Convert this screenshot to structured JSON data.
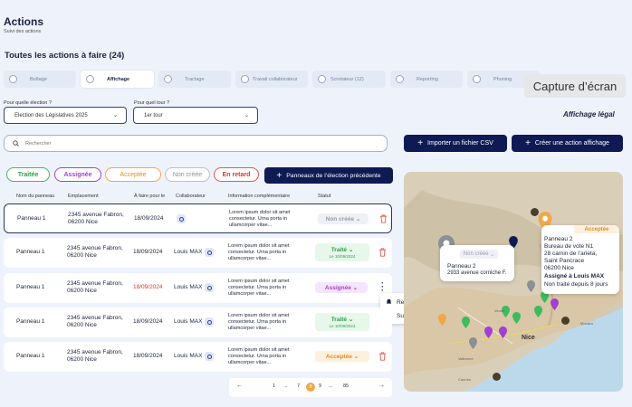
{
  "header": {
    "title": "Actions",
    "subtitle": "Suivi des actions",
    "todo_title": "Toutes les actions à faire (24)"
  },
  "tabs": [
    {
      "label": "Boîtage",
      "icon": "mailbox-icon"
    },
    {
      "label": "Affichage",
      "icon": "poster-icon",
      "active": true
    },
    {
      "label": "Tractage",
      "icon": "flyer-icon"
    },
    {
      "label": "Travail collaborateur",
      "icon": "team-icon"
    },
    {
      "label": "Scrutateur (12)",
      "icon": "ballot-icon"
    },
    {
      "label": "Reporting",
      "icon": "chart-icon"
    },
    {
      "label": "Phoning",
      "icon": "phone-icon"
    }
  ],
  "capture_label": "Capture d’écran",
  "filters": {
    "election_label": "Pour quelle élection ?",
    "election_value": "Election des Législatives 2025",
    "tour_label": "Pour quel tour ?",
    "tour_value": "1er tour"
  },
  "affichage_legal": "Affichage légal",
  "search": {
    "placeholder": "Rechercher"
  },
  "buttons": {
    "import_csv": "Importer un fichier CSV",
    "create_action": "Créer une action affichage",
    "previous_panels": "Panneaux de l’élection précédente"
  },
  "chips": {
    "traitee": "Traitée",
    "assignee": "Assignée",
    "acceptee": "Acceptée",
    "non_creee": "Non créée",
    "en_retard": "En retard"
  },
  "table": {
    "headers": {
      "name": "Nom du panneau",
      "location": "Emplacement",
      "due": "À faire pour le",
      "collab": "Collaborateur",
      "info": "Information complémentaire",
      "status": "Statut"
    },
    "rows": [
      {
        "name": "Panneau 1",
        "addr1": "2345 avenue Fabron,",
        "addr2": "06200 Nice",
        "date": "18/09/2024",
        "collab": "",
        "info": "Lorem ipsum dolor sit amet consectetur. Urna porta in ullamcorper vitae...",
        "status": "Non créée",
        "status_date": ""
      },
      {
        "name": "Panneau 1",
        "addr1": "2345 avenue Fabron,",
        "addr2": "06200 Nice",
        "date": "18/09/2024",
        "collab": "Louis MAX",
        "info": "Lorem ipsum dolor sit amet consectetur. Urna porta in ullamcorper vitae...",
        "status": "Traité",
        "status_date": "Le 10/09/2024"
      },
      {
        "name": "Panneau 1",
        "addr1": "2345 avenue Fabron,",
        "addr2": "06200 Nice",
        "date": "18/09/2024",
        "collab": "Louis MAX",
        "info": "Lorem ipsum dolor sit amet consectetur. Urna porta in ullamcorper vitae...",
        "status": "Assignée",
        "status_date": ""
      },
      {
        "name": "Panneau 1",
        "addr1": "2345 avenue Fabron,",
        "addr2": "06200 Nice",
        "date": "18/09/2024",
        "collab": "Louis MAX",
        "info": "Lorem ipsum dolor sit amet consectetur. Urna porta in ullamcorper vitae...",
        "status": "Traité",
        "status_date": "Le 10/09/2024"
      },
      {
        "name": "Panneau 1",
        "addr1": "2345 avenue Fabron,",
        "addr2": "06200 Nice",
        "date": "18/09/2024",
        "collab": "Louis MAX",
        "info": "Lorem ipsum dolor sit amet consectetur. Urna porta in ullamcorper vitae...",
        "status": "Acceptée",
        "status_date": ""
      }
    ]
  },
  "row_menu": {
    "remind": "Relancer",
    "delete": "Supprimer"
  },
  "pagination": {
    "pages": [
      "1",
      "...",
      "7",
      "8",
      "9",
      "...",
      "85"
    ],
    "current": "8"
  },
  "map": {
    "gray_popup": {
      "status": "Non créée",
      "name": "Panneau 2",
      "address": "2933 avenue corniche F."
    },
    "orange_popup": {
      "status": "Acceptée",
      "line1": "Panneau 2",
      "line2": "Bureau de vote N1",
      "line3": "28 camin de l’arieta,",
      "line4": "Saint Pancrace",
      "line5": "06200 Nice",
      "assigned": "Assigné à Louis MAX",
      "pending": "Non traité depuis 8 jours"
    },
    "city": "Nice",
    "places": [
      "Monaco",
      "Cannes",
      "Valbonne",
      "Vence",
      "Contes",
      "Menton"
    ]
  },
  "colors": {
    "navy": "#0f1a55",
    "green": "#3dbb5d",
    "purple": "#a33fd0",
    "orange": "#f0a74a",
    "gray": "#9aa0ae",
    "red": "#d03b31"
  }
}
